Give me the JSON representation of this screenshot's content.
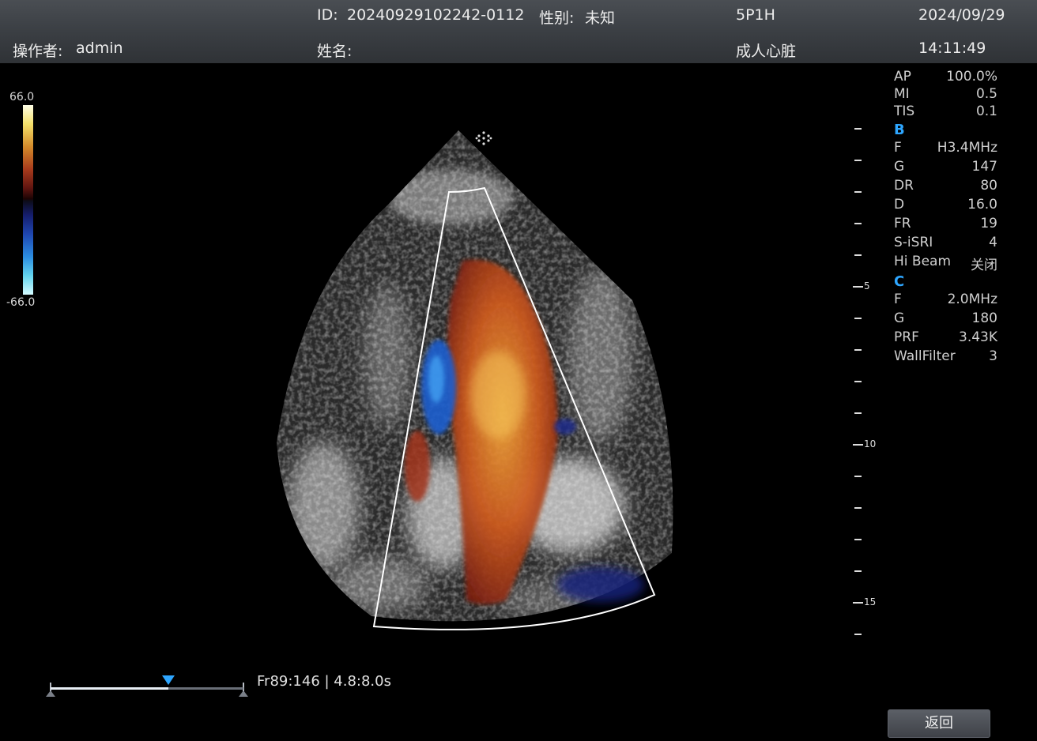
{
  "header": {
    "id_label": "ID:",
    "id_value": "20240929102242-0112",
    "gender_label": "性别:",
    "gender_value": "未知",
    "probe": "5P1H",
    "date": "2024/09/29",
    "operator_label": "操作者:",
    "operator_value": "admin",
    "name_label": "姓名:",
    "name_value": "",
    "preset": "成人心脏",
    "time": "14:11:49"
  },
  "color_scale": {
    "max": "66.0",
    "min": "-66.0"
  },
  "depth_ruler": {
    "labels": [
      "5",
      "10",
      "15"
    ]
  },
  "params": {
    "general": [
      {
        "key": "AP",
        "value": "100.0%"
      },
      {
        "key": "MI",
        "value": "0.5"
      },
      {
        "key": "TIS",
        "value": "0.1"
      }
    ],
    "b_mode": {
      "title": "B",
      "items": [
        {
          "key": "F",
          "value": "H3.4MHz"
        },
        {
          "key": "G",
          "value": "147"
        },
        {
          "key": "DR",
          "value": "80"
        },
        {
          "key": "D",
          "value": "16.0"
        },
        {
          "key": "FR",
          "value": "19"
        },
        {
          "key": "S-iSRI",
          "value": "4"
        },
        {
          "key": "Hi Beam",
          "value": "关闭"
        }
      ]
    },
    "c_mode": {
      "title": "C",
      "items": [
        {
          "key": "F",
          "value": "2.0MHz"
        },
        {
          "key": "G",
          "value": "180"
        },
        {
          "key": "PRF",
          "value": "3.43K"
        },
        {
          "key": "WallFilter",
          "value": "3"
        }
      ]
    }
  },
  "cine": {
    "frame_text": "Fr89:146 | 4.8:8.0s",
    "position": 0.61
  },
  "buttons": {
    "back": "返回"
  },
  "colors": {
    "accent": "#2ea6ff",
    "header_bg": "#3c4045"
  }
}
